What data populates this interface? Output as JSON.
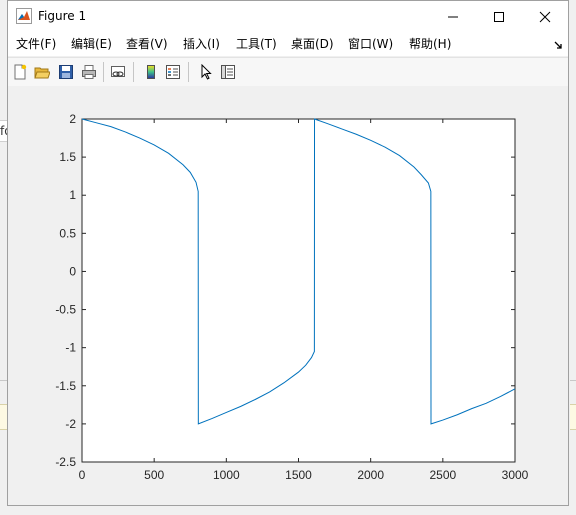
{
  "background": {
    "left_fragment_text": "fo"
  },
  "window": {
    "title": "Figure 1"
  },
  "menu": {
    "file": "文件(F)",
    "edit": "编辑(E)",
    "view": "查看(V)",
    "insert": "插入(I)",
    "tools": "工具(T)",
    "desktop": "桌面(D)",
    "window": "窗口(W)",
    "help": "帮助(H)"
  },
  "toolbar": {
    "icons": [
      "new-figure-icon",
      "open-file-icon",
      "save-figure-icon",
      "print-figure-icon",
      "link-plot-icon",
      "insert-colorbar-icon",
      "insert-legend-icon",
      "edit-plot-icon",
      "property-inspector-icon"
    ]
  },
  "colors": {
    "line": "#0072bd",
    "axes_background": "#ffffff",
    "figure_background": "#f0f0f0"
  },
  "chart_data": {
    "type": "line",
    "title": "",
    "xlabel": "",
    "ylabel": "",
    "xlim": [
      0,
      3000
    ],
    "ylim": [
      -2.5,
      2
    ],
    "xticks": [
      "0",
      "500",
      "1000",
      "1500",
      "2000",
      "2500",
      "3000"
    ],
    "yticks": [
      "2",
      "1.5",
      "1",
      "0.5",
      "0",
      "-0.5",
      "-1",
      "-1.5",
      "-2",
      "-2.5"
    ],
    "grid": false,
    "series": [
      {
        "x": [
          0,
          100,
          200,
          300,
          400,
          500,
          600,
          700,
          750,
          790,
          805,
          806,
          900,
          1000,
          1100,
          1200,
          1300,
          1400,
          1500,
          1550,
          1590,
          1610,
          1611,
          1700,
          1800,
          1900,
          2000,
          2100,
          2200,
          2300,
          2350,
          2400,
          2417,
          2418,
          2500,
          2600,
          2700,
          2800,
          2900,
          3000
        ],
        "y": [
          2.0,
          1.95,
          1.9,
          1.83,
          1.75,
          1.66,
          1.55,
          1.4,
          1.3,
          1.17,
          1.05,
          -2.0,
          -1.93,
          -1.85,
          -1.77,
          -1.68,
          -1.58,
          -1.46,
          -1.32,
          -1.23,
          -1.13,
          -1.05,
          2.0,
          1.94,
          1.87,
          1.8,
          1.72,
          1.63,
          1.52,
          1.37,
          1.27,
          1.16,
          1.05,
          -2.0,
          -1.95,
          -1.88,
          -1.8,
          -1.73,
          -1.64,
          -1.54
        ]
      }
    ]
  }
}
